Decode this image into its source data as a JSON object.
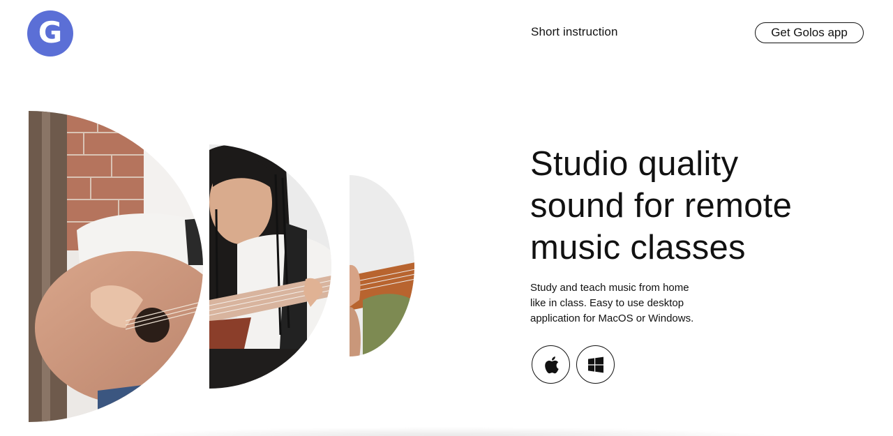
{
  "brand": {
    "logo_letter": "G",
    "logo_color": "#5b6fd6"
  },
  "header": {
    "nav_link": "Short instruction",
    "cta_label": "Get Golos app"
  },
  "hero": {
    "headline_lines": [
      "Studio quality",
      "sound for remote",
      "music classes"
    ],
    "subcopy_lines": [
      "Study and teach music from home",
      "like in class. Easy to use desktop",
      "application for MacOS or Windows."
    ],
    "platforms": [
      {
        "icon": "apple-icon",
        "name": "MacOS"
      },
      {
        "icon": "windows-icon",
        "name": "Windows"
      }
    ]
  },
  "colors": {
    "text": "#111111",
    "background": "#ffffff"
  }
}
